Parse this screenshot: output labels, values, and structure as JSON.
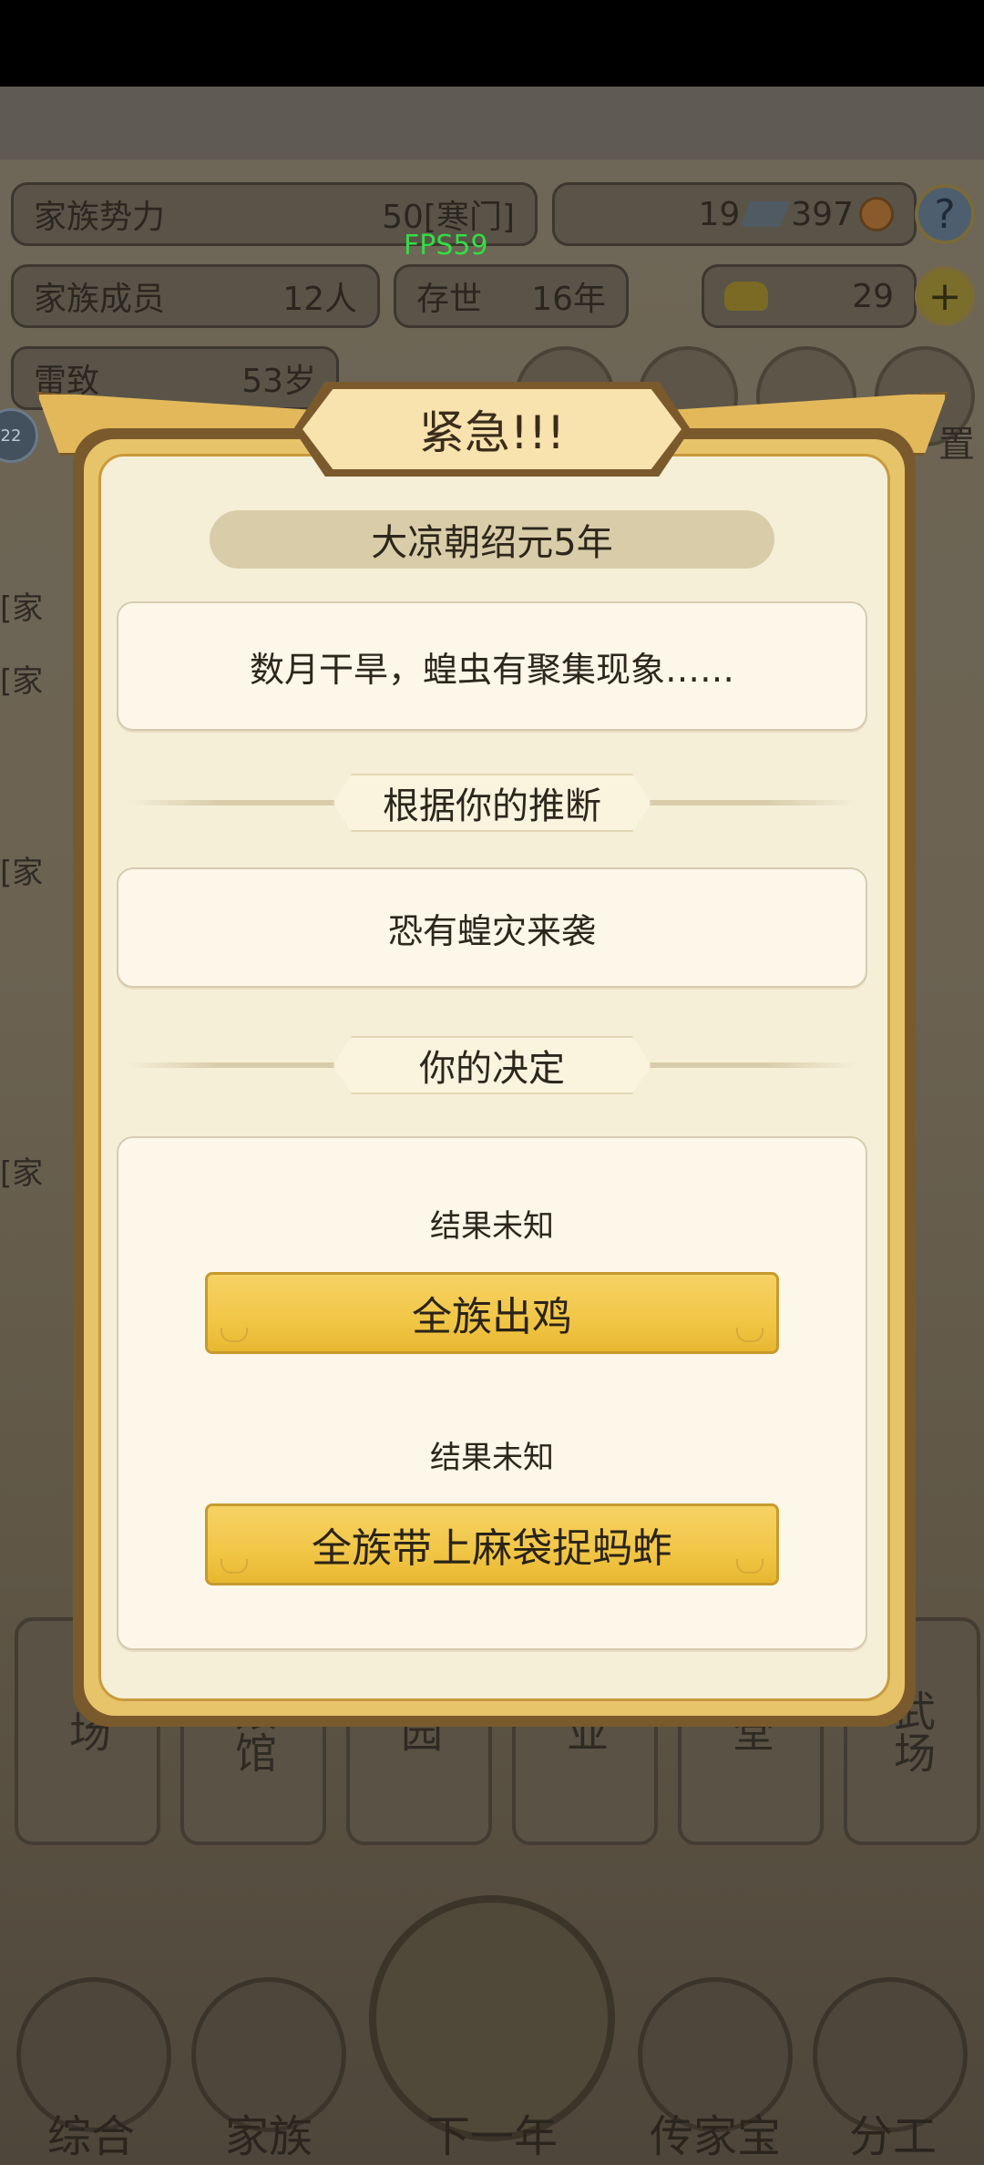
{
  "hud": {
    "clan_power_label": "家族势力",
    "clan_power_value": "50[寒门]",
    "currency_a": "19",
    "currency_b": "397",
    "help": "?",
    "members_label": "家族成员",
    "members_value": "12人",
    "survival_label": "存世",
    "survival_value": "16年",
    "gold_value": "29",
    "plus": "+",
    "leader_name": "雷致",
    "leader_age": "53岁",
    "fps": "FPS59",
    "side_badge": "22",
    "partial_right": "置"
  },
  "modal": {
    "title": "紧急!!!",
    "era": "大凉朝绍元5年",
    "event_text": "数月干旱，蝗虫有聚集现象……",
    "judgement_label": "根据你的推断",
    "judgement_text": "恐有蝗灾来袭",
    "decision_label": "你的决定",
    "options": [
      {
        "result": "结果未知",
        "label": "全族出鸡"
      },
      {
        "result": "结果未知",
        "label": "全族带上麻袋捉蚂蚱"
      }
    ]
  },
  "buildings": [
    "场",
    "娘馆",
    "园",
    "业",
    "堂",
    "武场"
  ],
  "nav": {
    "items": [
      "综合",
      "家族",
      "下一年",
      "传家宝",
      "分工"
    ]
  },
  "colors": {
    "modal_bg": "#f6f0db",
    "button_gold": "#f1c646",
    "fps_green": "#33dd44"
  }
}
